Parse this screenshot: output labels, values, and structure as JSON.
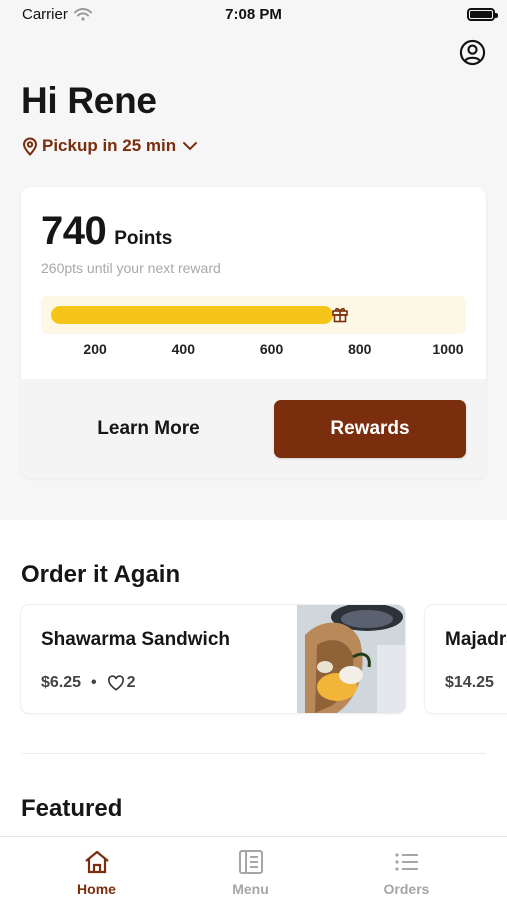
{
  "status": {
    "carrier": "Carrier",
    "time": "7:08 PM"
  },
  "header": {
    "greeting": "Hi Rene",
    "pickup": "Pickup in 25 min"
  },
  "points": {
    "value": "740",
    "label": "Points",
    "subtitle": "260pts until your next reward",
    "progress": {
      "value": 740,
      "max": 1000,
      "min": 100
    },
    "ticks": [
      "200",
      "400",
      "600",
      "800",
      "1000"
    ],
    "learn_more_label": "Learn More",
    "rewards_label": "Rewards"
  },
  "order_again": {
    "title": "Order it Again",
    "items": [
      {
        "name": "Shawarma Sandwich",
        "price": "$6.25",
        "dot": "•",
        "likes": "2"
      },
      {
        "name": "Majadra",
        "price": "$14.25"
      }
    ]
  },
  "featured": {
    "title": "Featured"
  },
  "tabs": [
    {
      "label": "Home",
      "icon": "home-icon",
      "active": true
    },
    {
      "label": "Menu",
      "icon": "menu-book-icon",
      "active": false
    },
    {
      "label": "Orders",
      "icon": "list-icon",
      "active": false
    }
  ],
  "colors": {
    "brand": "#7a2e0e",
    "progress_fill": "#f6c519",
    "progress_track": "#fdf8e6",
    "tab_inactive": "#a6a6a6"
  }
}
